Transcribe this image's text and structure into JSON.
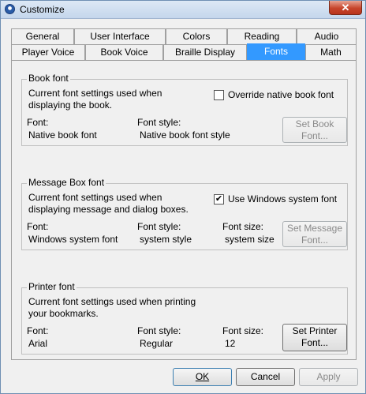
{
  "window": {
    "title": "Customize",
    "close": "✕"
  },
  "tabs_row1": [
    "General",
    "User Interface",
    "Colors",
    "Reading",
    "Audio"
  ],
  "tabs_row2": [
    "Player Voice",
    "Book Voice",
    "Braille Display",
    "Fonts",
    "Math"
  ],
  "active_tab": "Fonts",
  "book_font": {
    "legend": "Book font",
    "desc_line1": "Current font settings used when",
    "desc_line2": "displaying the book.",
    "override_label": "Override native book font",
    "override_checked": false,
    "font_label": "Font:",
    "font_value": "Native book font",
    "style_label": "Font style:",
    "style_value": "Native book font style",
    "button_line1": "Set Book",
    "button_line2": "Font..."
  },
  "message_font": {
    "legend": "Message Box font",
    "desc_line1": "Current font settings used when",
    "desc_line2": "displaying message and dialog boxes.",
    "system_label": "Use Windows system font",
    "system_checked": true,
    "check_mark": "✔",
    "font_label": "Font:",
    "font_value": "Windows system font",
    "style_label": "Font style:",
    "style_value": "system style",
    "size_label": "Font size:",
    "size_value": "system size",
    "button_line1": "Set Message",
    "button_line2": "Font..."
  },
  "printer_font": {
    "legend": "Printer font",
    "desc_line1": "Current font settings used when printing",
    "desc_line2": "your bookmarks.",
    "font_label": "Font:",
    "font_value": "Arial",
    "style_label": "Font style:",
    "style_value": "Regular",
    "size_label": "Font size:",
    "size_value": "12",
    "button_line1": "Set Printer",
    "button_line2": "Font..."
  },
  "buttons": {
    "ok": "OK",
    "cancel": "Cancel",
    "apply": "Apply"
  },
  "colors": {
    "active_tab": "#3399ff",
    "titlebar": "#c4d6ec",
    "close": "#c7452c"
  }
}
